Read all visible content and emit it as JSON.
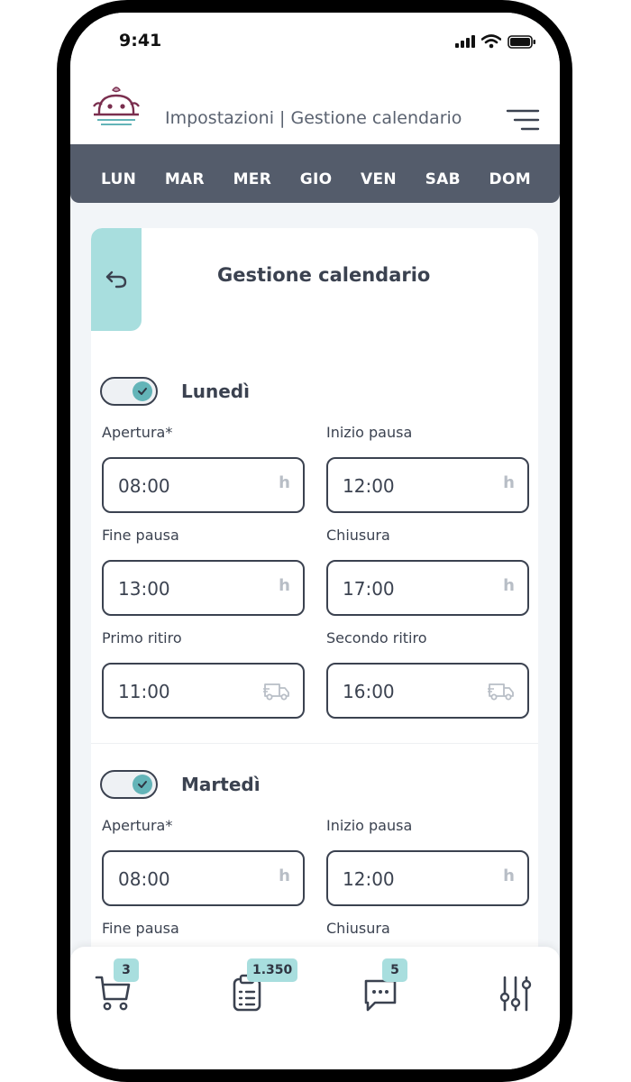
{
  "status_bar": {
    "time": "9:41"
  },
  "header": {
    "title": "Impostazioni | Gestione calendario"
  },
  "days": [
    "LUN",
    "MAR",
    "MER",
    "GIO",
    "VEN",
    "SAB",
    "DOM"
  ],
  "card": {
    "title": "Gestione calendario"
  },
  "sections": [
    {
      "day": "Lunedì",
      "enabled": true,
      "fields": {
        "opening": {
          "label": "Apertura*",
          "value": "08:00",
          "suffix": "h"
        },
        "break_start": {
          "label": "Inizio pausa",
          "value": "12:00",
          "suffix": "h"
        },
        "break_end": {
          "label": "Fine pausa",
          "value": "13:00",
          "suffix": "h"
        },
        "closing": {
          "label": "Chiusura",
          "value": "17:00",
          "suffix": "h"
        },
        "first_pickup": {
          "label": "Primo ritiro",
          "value": "11:00",
          "icon": "truck-icon"
        },
        "second_pickup": {
          "label": "Secondo ritiro",
          "value": "16:00",
          "icon": "truck-icon"
        }
      }
    },
    {
      "day": "Martedì",
      "enabled": true,
      "fields": {
        "opening": {
          "label": "Apertura*",
          "value": "08:00",
          "suffix": "h"
        },
        "break_start": {
          "label": "Inizio pausa",
          "value": "12:00",
          "suffix": "h"
        },
        "break_end": {
          "label": "Fine pausa"
        },
        "closing": {
          "label": "Chiusura"
        }
      }
    }
  ],
  "bottom_nav": {
    "cart": {
      "badge": "3",
      "icon": "cart-icon"
    },
    "orders": {
      "badge": "1.350",
      "icon": "clipboard-icon"
    },
    "messages": {
      "badge": "5",
      "icon": "chat-icon"
    },
    "settings": {
      "icon": "sliders-icon"
    }
  },
  "colors": {
    "accent": "#a8dede",
    "toggle_knob": "#63b4b8",
    "days_bar": "#545c6b",
    "text": "#3b4250",
    "logo": "#7a2e4e"
  }
}
